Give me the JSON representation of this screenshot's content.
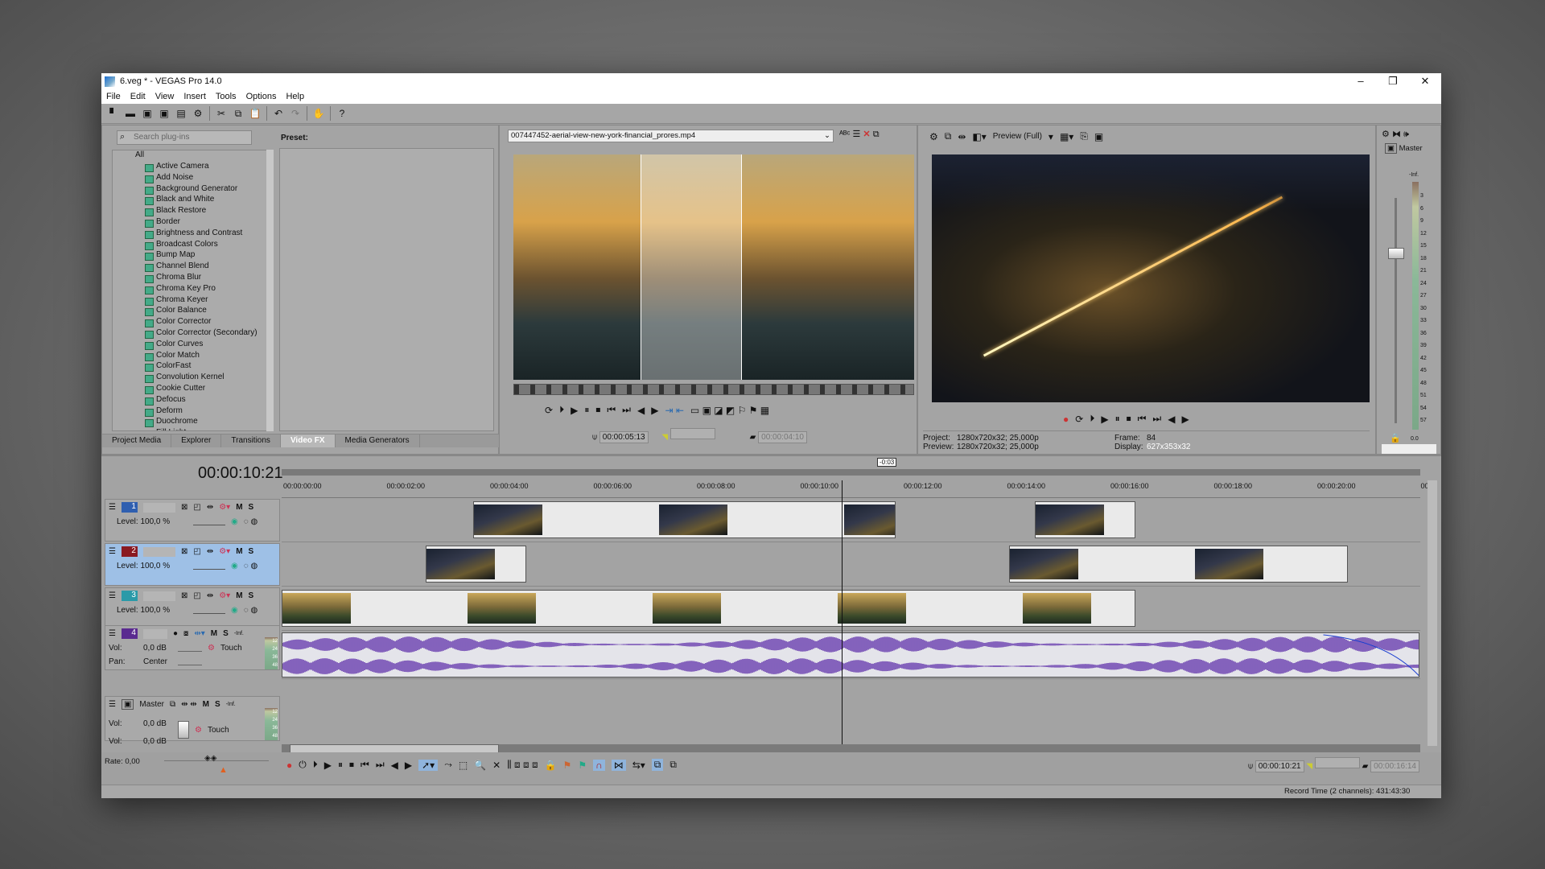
{
  "window": {
    "title": "6.veg * - VEGAS Pro 14.0",
    "controls": [
      "–",
      "❐",
      "✕"
    ]
  },
  "menu": [
    "File",
    "Edit",
    "View",
    "Insert",
    "Tools",
    "Options",
    "Help"
  ],
  "toolbar": [
    "new",
    "open",
    "save",
    "save-as",
    "render",
    "properties",
    "cut",
    "copy",
    "paste",
    "undo",
    "redo",
    "hand",
    "help"
  ],
  "plugins": {
    "search_placeholder": "Search plug-ins",
    "preset_label": "Preset:",
    "root": "All",
    "items": [
      "Active Camera",
      "Add Noise",
      "Background Generator",
      "Black and White",
      "Black Restore",
      "Border",
      "Brightness and Contrast",
      "Broadcast Colors",
      "Bump Map",
      "Channel Blend",
      "Chroma Blur",
      "Chroma Key Pro",
      "Chroma Keyer",
      "Color Balance",
      "Color Corrector",
      "Color Corrector (Secondary)",
      "Color Curves",
      "Color Match",
      "ColorFast",
      "Convolution Kernel",
      "Cookie Cutter",
      "Defocus",
      "Deform",
      "Duochrome",
      "Fill Light"
    ],
    "tabs": [
      "Project Media",
      "Explorer",
      "Transitions",
      "Video FX",
      "Media Generators"
    ],
    "active_tab": "Video FX"
  },
  "trimmer": {
    "file": "007447452-aerial-view-new-york-financial_prores.mp4",
    "cursor": "00:00:05:13",
    "in": "",
    "length": "00:00:04:10"
  },
  "preview": {
    "quality": "Preview (Full)",
    "project": "1280x720x32; 25,000p",
    "preview": "1280x720x32; 25,000p",
    "frame": "84",
    "display": "627x353x32",
    "labels": {
      "project": "Project:",
      "preview": "Preview:",
      "frame": "Frame:",
      "display": "Display:"
    }
  },
  "master_bus": {
    "label": "Master",
    "top": "-Inf.",
    "bottom": "0.0",
    "scale": [
      "3",
      "6",
      "9",
      "12",
      "15",
      "18",
      "21",
      "24",
      "27",
      "30",
      "33",
      "36",
      "39",
      "42",
      "45",
      "48",
      "51",
      "54",
      "57"
    ]
  },
  "timeline": {
    "current_time": "00:00:10:21",
    "cursor_seconds": 10.84,
    "region_label": "-0:03",
    "ruler": [
      "00:00:00:00",
      "00:00:02:00",
      "00:00:04:00",
      "00:00:06:00",
      "00:00:08:00",
      "00:00:10:00",
      "00:00:12:00",
      "00:00:14:00",
      "00:00:16:00",
      "00:00:18:00",
      "00:00:20:00",
      "00"
    ],
    "tracks": [
      {
        "num": "1",
        "color": "#2f5fb0",
        "level": "Level: 100,0 %",
        "clips": [
          [
            3.7,
            11.88
          ],
          [
            14.57,
            16.51
          ]
        ],
        "selected": false
      },
      {
        "num": "2",
        "color": "#8a1a22",
        "level": "Level: 100,0 %",
        "clips": [
          [
            2.78,
            4.73
          ],
          [
            14.07,
            20.63
          ]
        ],
        "selected": true
      },
      {
        "num": "3",
        "color": "#2a9aa8",
        "level": "Level: 100,0 %",
        "clips": [
          [
            0,
            16.51
          ]
        ],
        "selected": false
      }
    ],
    "audio": {
      "num": "4",
      "color": "#5a2a90",
      "vol_label": "Vol:",
      "vol": "0,0 dB",
      "pan_label": "Pan:",
      "pan": "Center",
      "mode": "Touch",
      "meter_top": "-Inf.",
      "meter": [
        "12",
        "24",
        "36",
        "48"
      ],
      "clip": [
        0,
        22.0
      ]
    },
    "master": {
      "label": "Master",
      "vol_label": "Vol:",
      "vol1": "0,0 dB",
      "vol2": "0,0 dB",
      "mode": "Touch",
      "meter_top": "-Inf.",
      "meter": [
        "12",
        "24",
        "36",
        "48"
      ]
    },
    "mute": "M",
    "solo": "S"
  },
  "transport": {
    "rate": "Rate: 0,00",
    "cursor": "00:00:10:21",
    "selection": "",
    "length": "00:00:16:14"
  },
  "status": {
    "record_time": "Record Time (2 channels): 431:43:30"
  }
}
